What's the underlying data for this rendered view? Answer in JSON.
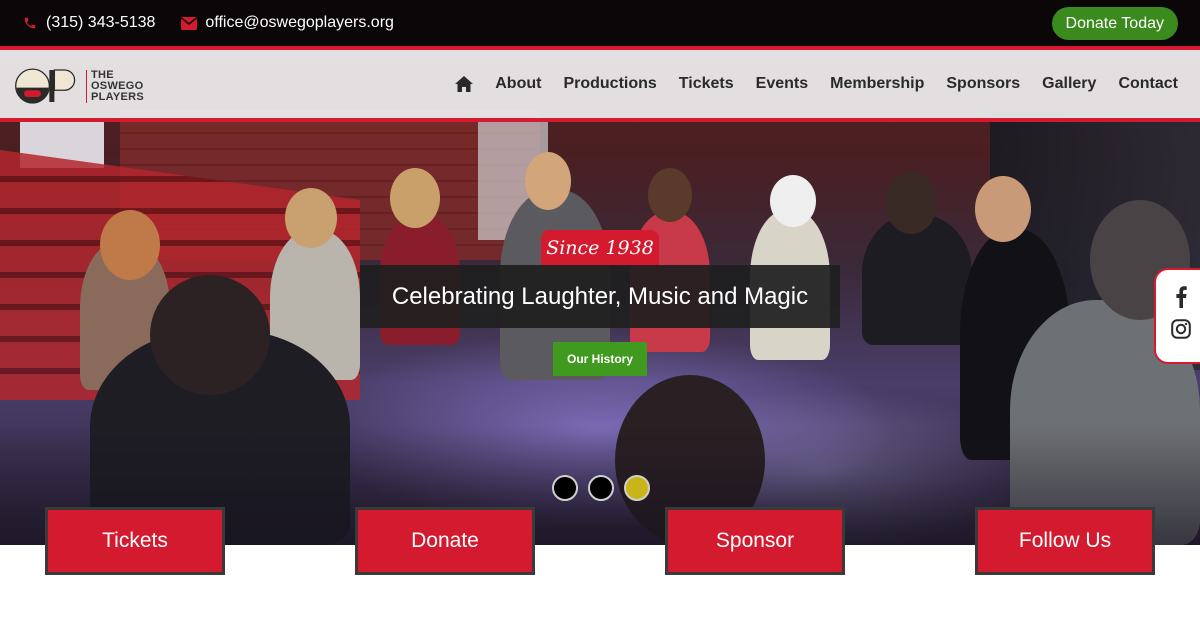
{
  "topbar": {
    "phone": "(315) 343-5138",
    "email": "office@oswegoplayers.org",
    "donate_label": "Donate Today"
  },
  "logo": {
    "monogram": "OP",
    "line1": "THE",
    "line2": "OSWEGO",
    "line3": "PLAYERS"
  },
  "nav": {
    "items": [
      {
        "label": "About"
      },
      {
        "label": "Productions"
      },
      {
        "label": "Tickets"
      },
      {
        "label": "Events"
      },
      {
        "label": "Membership"
      },
      {
        "label": "Sponsors"
      },
      {
        "label": "Gallery"
      },
      {
        "label": "Contact"
      }
    ]
  },
  "hero": {
    "since": "Since 1938",
    "headline": "Celebrating Laughter, Music and Magic",
    "button": "Our History",
    "slide_count": 3,
    "active_slide": 3
  },
  "cta": [
    {
      "label": "Tickets"
    },
    {
      "label": "Donate"
    },
    {
      "label": "Sponsor"
    },
    {
      "label": "Follow Us"
    }
  ],
  "colors": {
    "brand_red": "#d31a2e",
    "donate_green": "#3a8a1e",
    "active_dot": "#c9b51a"
  },
  "icons": [
    "phone-icon",
    "envelope-icon",
    "home-icon",
    "facebook-icon",
    "instagram-icon"
  ]
}
